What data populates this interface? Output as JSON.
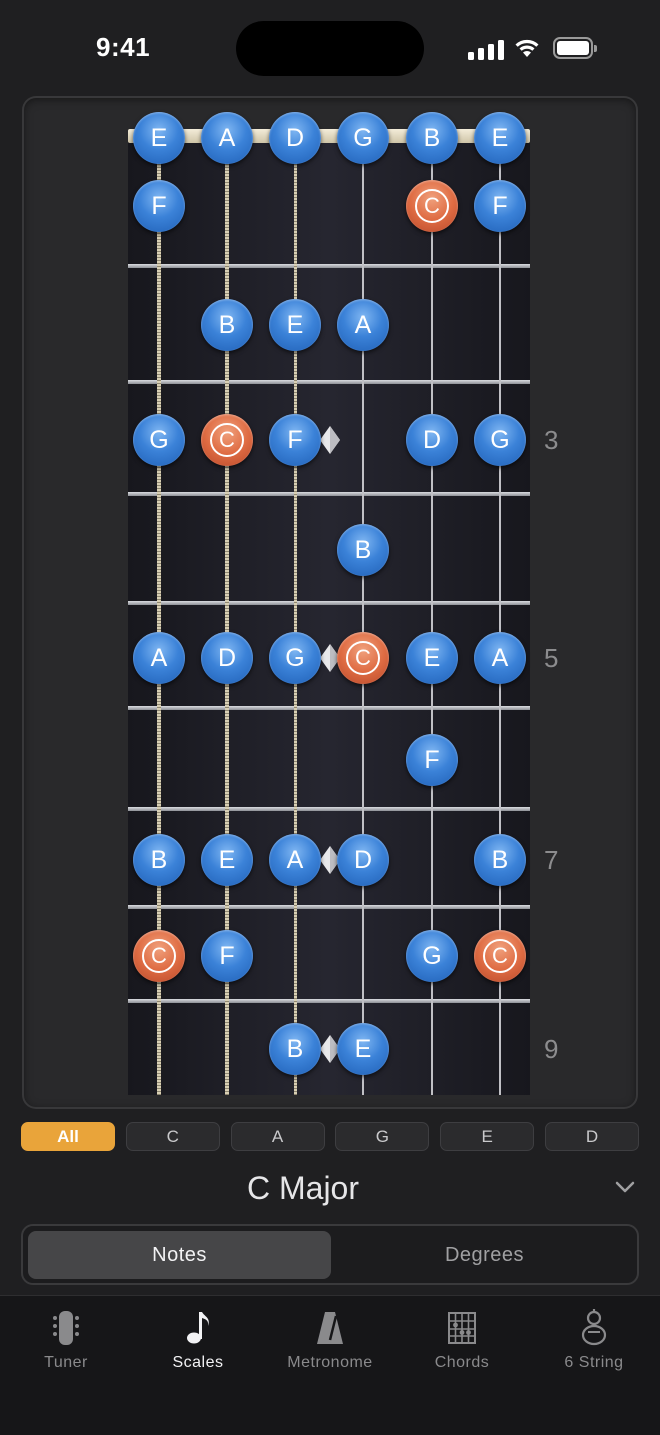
{
  "status_bar": {
    "time": "9:41"
  },
  "fretboard": {
    "strings": [
      "E",
      "A",
      "D",
      "G",
      "B",
      "E"
    ],
    "fret_numbers": [
      "3",
      "5",
      "7",
      "9"
    ],
    "notes": [
      {
        "fret": 0,
        "string": 0,
        "label": "E",
        "root": false
      },
      {
        "fret": 0,
        "string": 1,
        "label": "A",
        "root": false
      },
      {
        "fret": 0,
        "string": 2,
        "label": "D",
        "root": false
      },
      {
        "fret": 0,
        "string": 3,
        "label": "G",
        "root": false
      },
      {
        "fret": 0,
        "string": 4,
        "label": "B",
        "root": false
      },
      {
        "fret": 0,
        "string": 5,
        "label": "E",
        "root": false
      },
      {
        "fret": 1,
        "string": 0,
        "label": "F",
        "root": false
      },
      {
        "fret": 1,
        "string": 4,
        "label": "C",
        "root": true
      },
      {
        "fret": 1,
        "string": 5,
        "label": "F",
        "root": false
      },
      {
        "fret": 2,
        "string": 1,
        "label": "B",
        "root": false
      },
      {
        "fret": 2,
        "string": 2,
        "label": "E",
        "root": false
      },
      {
        "fret": 2,
        "string": 3,
        "label": "A",
        "root": false
      },
      {
        "fret": 3,
        "string": 0,
        "label": "G",
        "root": false
      },
      {
        "fret": 3,
        "string": 1,
        "label": "C",
        "root": true
      },
      {
        "fret": 3,
        "string": 2,
        "label": "F",
        "root": false
      },
      {
        "fret": 3,
        "string": 4,
        "label": "D",
        "root": false
      },
      {
        "fret": 3,
        "string": 5,
        "label": "G",
        "root": false
      },
      {
        "fret": 4,
        "string": 3,
        "label": "B",
        "root": false
      },
      {
        "fret": 5,
        "string": 0,
        "label": "A",
        "root": false
      },
      {
        "fret": 5,
        "string": 1,
        "label": "D",
        "root": false
      },
      {
        "fret": 5,
        "string": 2,
        "label": "G",
        "root": false
      },
      {
        "fret": 5,
        "string": 3,
        "label": "C",
        "root": true
      },
      {
        "fret": 5,
        "string": 4,
        "label": "E",
        "root": false
      },
      {
        "fret": 5,
        "string": 5,
        "label": "A",
        "root": false
      },
      {
        "fret": 6,
        "string": 4,
        "label": "F",
        "root": false
      },
      {
        "fret": 7,
        "string": 0,
        "label": "B",
        "root": false
      },
      {
        "fret": 7,
        "string": 1,
        "label": "E",
        "root": false
      },
      {
        "fret": 7,
        "string": 2,
        "label": "A",
        "root": false
      },
      {
        "fret": 7,
        "string": 3,
        "label": "D",
        "root": false
      },
      {
        "fret": 7,
        "string": 5,
        "label": "B",
        "root": false
      },
      {
        "fret": 8,
        "string": 0,
        "label": "C",
        "root": true
      },
      {
        "fret": 8,
        "string": 1,
        "label": "F",
        "root": false
      },
      {
        "fret": 8,
        "string": 4,
        "label": "G",
        "root": false
      },
      {
        "fret": 8,
        "string": 5,
        "label": "C",
        "root": true
      },
      {
        "fret": 9,
        "string": 2,
        "label": "B",
        "root": false
      },
      {
        "fret": 9,
        "string": 3,
        "label": "E",
        "root": false
      }
    ],
    "colors": {
      "note": "#3b82d8",
      "root_note": "#df6c43"
    }
  },
  "filters": {
    "items": [
      "All",
      "C",
      "A",
      "G",
      "E",
      "D"
    ],
    "active": "All",
    "active_color": "#e9a43a"
  },
  "scale": {
    "name": "C Major"
  },
  "display_mode": {
    "notes_label": "Notes",
    "degrees_label": "Degrees",
    "selected": "Notes"
  },
  "tab_bar": {
    "items": [
      {
        "label": "Tuner",
        "icon": "tuner-icon"
      },
      {
        "label": "Scales",
        "icon": "music-note-icon"
      },
      {
        "label": "Metronome",
        "icon": "metronome-icon"
      },
      {
        "label": "Chords",
        "icon": "chord-grid-icon"
      },
      {
        "label": "6 String",
        "icon": "guitar-icon"
      }
    ],
    "active": "Scales"
  }
}
